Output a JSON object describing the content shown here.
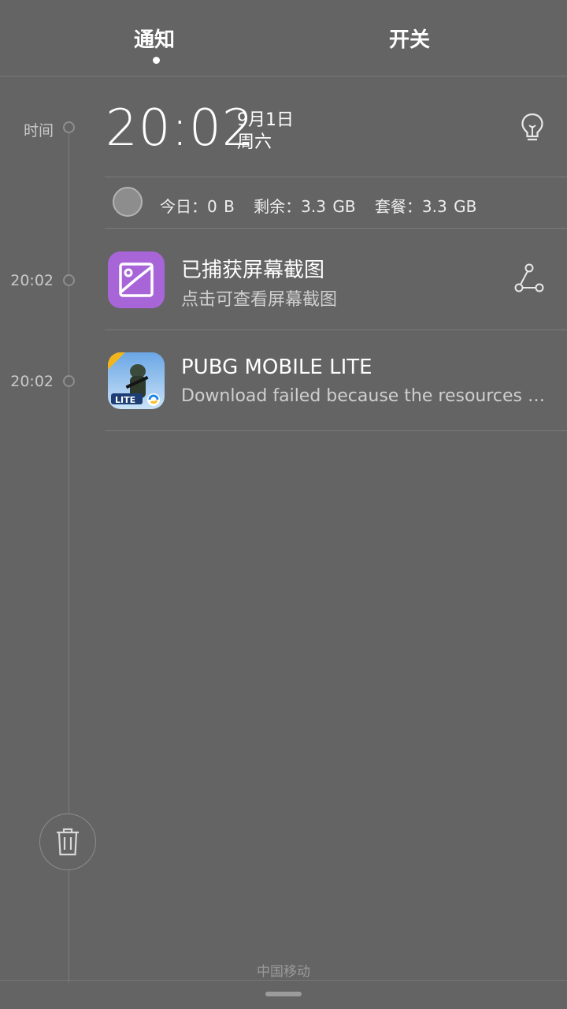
{
  "tabs": {
    "notifications": "通知",
    "toggles": "开关"
  },
  "timeline": {
    "time_label": "时间",
    "items": [
      {
        "time": "20:02"
      },
      {
        "time": "20:02"
      }
    ]
  },
  "clock": {
    "time": "20:02",
    "date": "9月1日",
    "weekday": "周六"
  },
  "data_usage": {
    "today": "今日：0 B",
    "remaining": "剩余：3.3 GB",
    "plan": "套餐：3.3 GB"
  },
  "notifications": [
    {
      "title": "已捕获屏幕截图",
      "body": "点击可查看屏幕截图",
      "icon": "screenshot-app-icon",
      "icon_color": "#a865d8"
    },
    {
      "title": "PUBG MOBILE LITE",
      "body": "Download failed because the resources could not be found.",
      "icon": "pubg-mobile-lite-icon"
    }
  ],
  "carrier": "中国移动",
  "colors": {
    "background": "#646464",
    "accent_purple": "#a865d8"
  }
}
